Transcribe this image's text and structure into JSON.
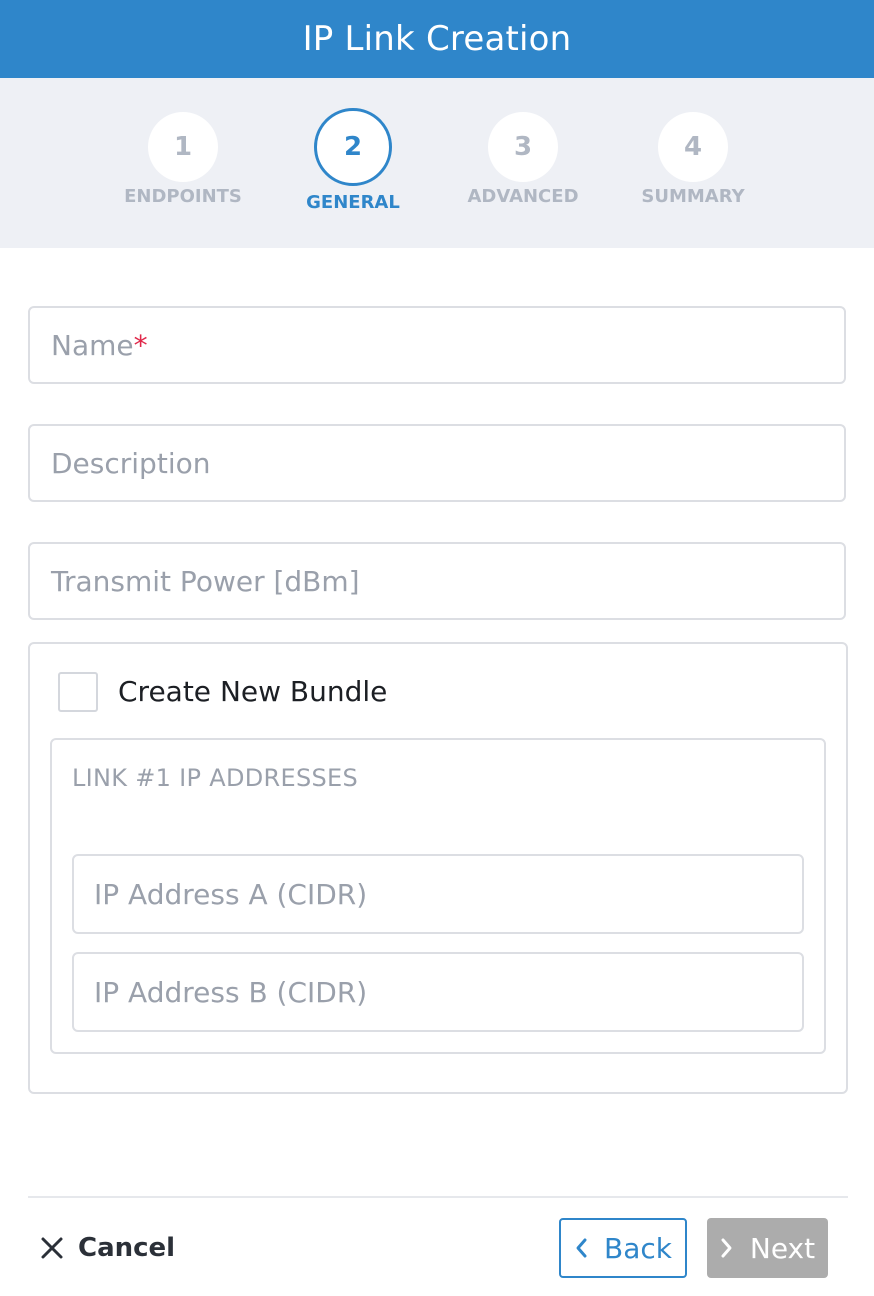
{
  "header": {
    "title": "IP Link Creation"
  },
  "steps": [
    {
      "number": "1",
      "label": "ENDPOINTS",
      "active": false
    },
    {
      "number": "2",
      "label": "GENERAL",
      "active": true
    },
    {
      "number": "3",
      "label": "ADVANCED",
      "active": false
    },
    {
      "number": "4",
      "label": "SUMMARY",
      "active": false
    }
  ],
  "form": {
    "name": {
      "placeholder": "Name",
      "required_mark": "*",
      "value": ""
    },
    "description": {
      "placeholder": "Description",
      "value": ""
    },
    "transmit_power": {
      "placeholder": "Transmit Power [dBm]",
      "value": ""
    },
    "bundle": {
      "checkbox_label": "Create New Bundle",
      "checked": false,
      "link_title": "LINK #1 IP ADDRESSES",
      "ip_a": {
        "placeholder": "IP Address A (CIDR)",
        "value": ""
      },
      "ip_b": {
        "placeholder": "IP Address B (CIDR)",
        "value": ""
      }
    }
  },
  "footer": {
    "cancel_label": "Cancel",
    "back_label": "Back",
    "next_label": "Next"
  },
  "colors": {
    "primary": "#2f86ca",
    "stepper_bg": "#eef0f5",
    "required": "#e0284a",
    "next_disabled": "#acacac"
  },
  "icons": {
    "cancel": "close-icon",
    "back": "chevron-left-icon",
    "next": "chevron-right-icon"
  }
}
